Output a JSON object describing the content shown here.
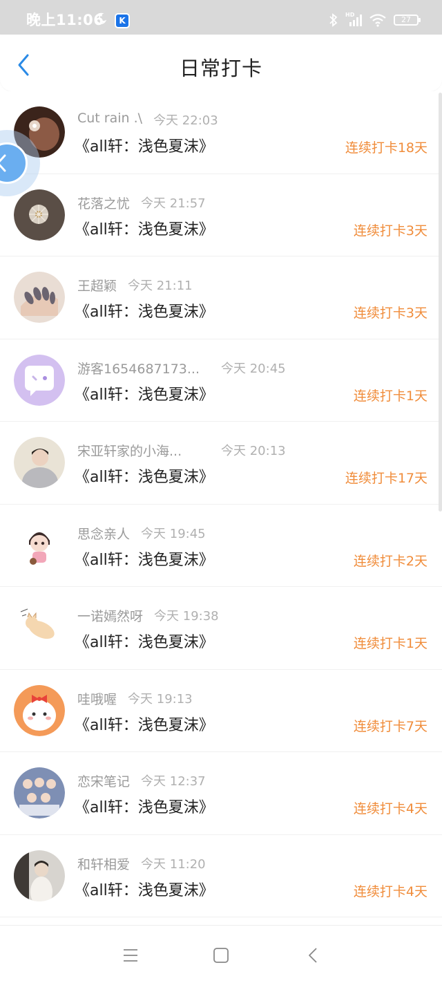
{
  "status_bar": {
    "time": "晚上11:06",
    "moon_icon": "moon-icon",
    "app_badge": "K",
    "icons": [
      "bluetooth-icon",
      "signal-icon",
      "wifi-icon"
    ],
    "network_label": "HD",
    "battery": "27"
  },
  "header": {
    "title": "日常打卡",
    "back_icon": "chevron-left-icon"
  },
  "records": [
    {
      "name": "Cut rain .\\",
      "time": "今天 22:03",
      "book": "《all轩：浅色夏沫》",
      "streak": "连续打卡18天"
    },
    {
      "name": "花落之忧",
      "time": "今天 21:57",
      "book": "《all轩：浅色夏沫》",
      "streak": "连续打卡3天"
    },
    {
      "name": "王超颖",
      "time": "今天 21:11",
      "book": "《all轩：浅色夏沫》",
      "streak": "连续打卡3天"
    },
    {
      "name": "游客1654687173...",
      "time": "今天 20:45",
      "book": "《all轩：浅色夏沫》",
      "streak": "连续打卡1天"
    },
    {
      "name": "宋亚轩家的小海...",
      "time": "今天 20:13",
      "book": "《all轩：浅色夏沫》",
      "streak": "连续打卡17天"
    },
    {
      "name": "思念亲人",
      "time": "今天 19:45",
      "book": "《all轩：浅色夏沫》",
      "streak": "连续打卡2天"
    },
    {
      "name": "一诺嫣然呀",
      "time": "今天 19:38",
      "book": "《all轩：浅色夏沫》",
      "streak": "连续打卡1天"
    },
    {
      "name": "哇哦喔",
      "time": "今天 19:13",
      "book": "《all轩：浅色夏沫》",
      "streak": "连续打卡7天"
    },
    {
      "name": "恋宋笔记",
      "time": "今天 12:37",
      "book": "《all轩：浅色夏沫》",
      "streak": "连续打卡4天"
    },
    {
      "name": "和轩相爱",
      "time": "今天 11:20",
      "book": "《all轩：浅色夏沫》",
      "streak": "连续打卡4天"
    }
  ],
  "nav_bar": {
    "icons": [
      "menu-icon",
      "home-square-icon",
      "back-triangle-icon"
    ]
  },
  "colors": {
    "accent_orange": "#f08c3a",
    "back_blue": "#2a8ae6",
    "float_blue": "#6aaef0"
  }
}
